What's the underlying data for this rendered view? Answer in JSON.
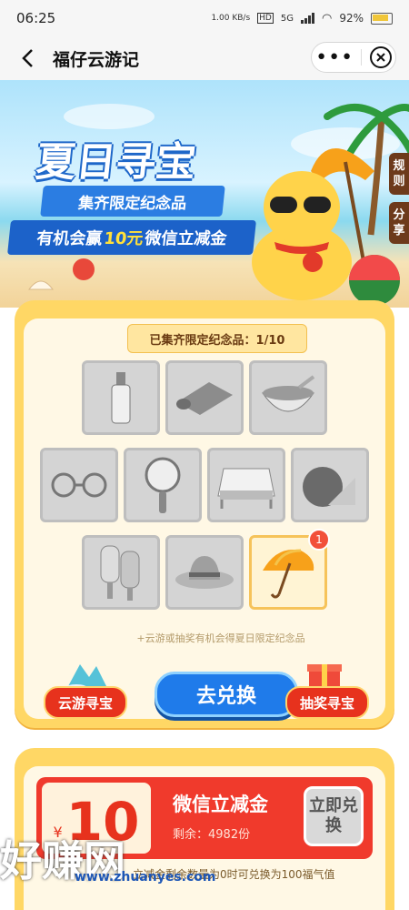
{
  "status": {
    "time": "06:25",
    "net_speed": "1.00 KB/s",
    "hd": "HD",
    "net": "5G",
    "battery": "92%"
  },
  "nav": {
    "title": "福仔云游记",
    "more": "•••",
    "close": "⨂"
  },
  "banner": {
    "title": "夏日寻宝",
    "ribbon1": "集齐限定纪念品",
    "ribbon2_prefix": "有机会赢",
    "ribbon2_amount": "10元",
    "ribbon2_suffix": "微信立减金",
    "rules_tab": "规则",
    "share_tab": "分享"
  },
  "collection": {
    "progress_label": "已集齐限定纪念品：1/10",
    "items": [
      {
        "name": "bottle-icon"
      },
      {
        "name": "mat-icon"
      },
      {
        "name": "bowl-icon"
      },
      {
        "name": "sunglasses-icon"
      },
      {
        "name": "fan-icon"
      },
      {
        "name": "bed-icon"
      },
      {
        "name": "watermelon-icon"
      },
      {
        "name": "popsicle-icon"
      },
      {
        "name": "straw-hat-icon"
      },
      {
        "name": "umbrella-icon",
        "collected": true,
        "count": "1"
      }
    ],
    "hint": "+云游或抽奖有机会得夏日限定纪念品",
    "btn_left": "云游寻宝",
    "btn_center": "去兑换",
    "btn_right": "抽奖寻宝"
  },
  "reward": {
    "currency": "¥",
    "amount": "10",
    "title": "微信立减金",
    "remaining": "剩余：4982份",
    "btn": "立即兑换",
    "note": "立减金剩余数量为0时可兑换为100福气值"
  },
  "watermark": {
    "text": "好赚网",
    "sub": "www.zhuanyes.com"
  },
  "colors": {
    "primary_blue": "#1f7bea",
    "red": "#e7321d",
    "gold": "#ffd765"
  }
}
